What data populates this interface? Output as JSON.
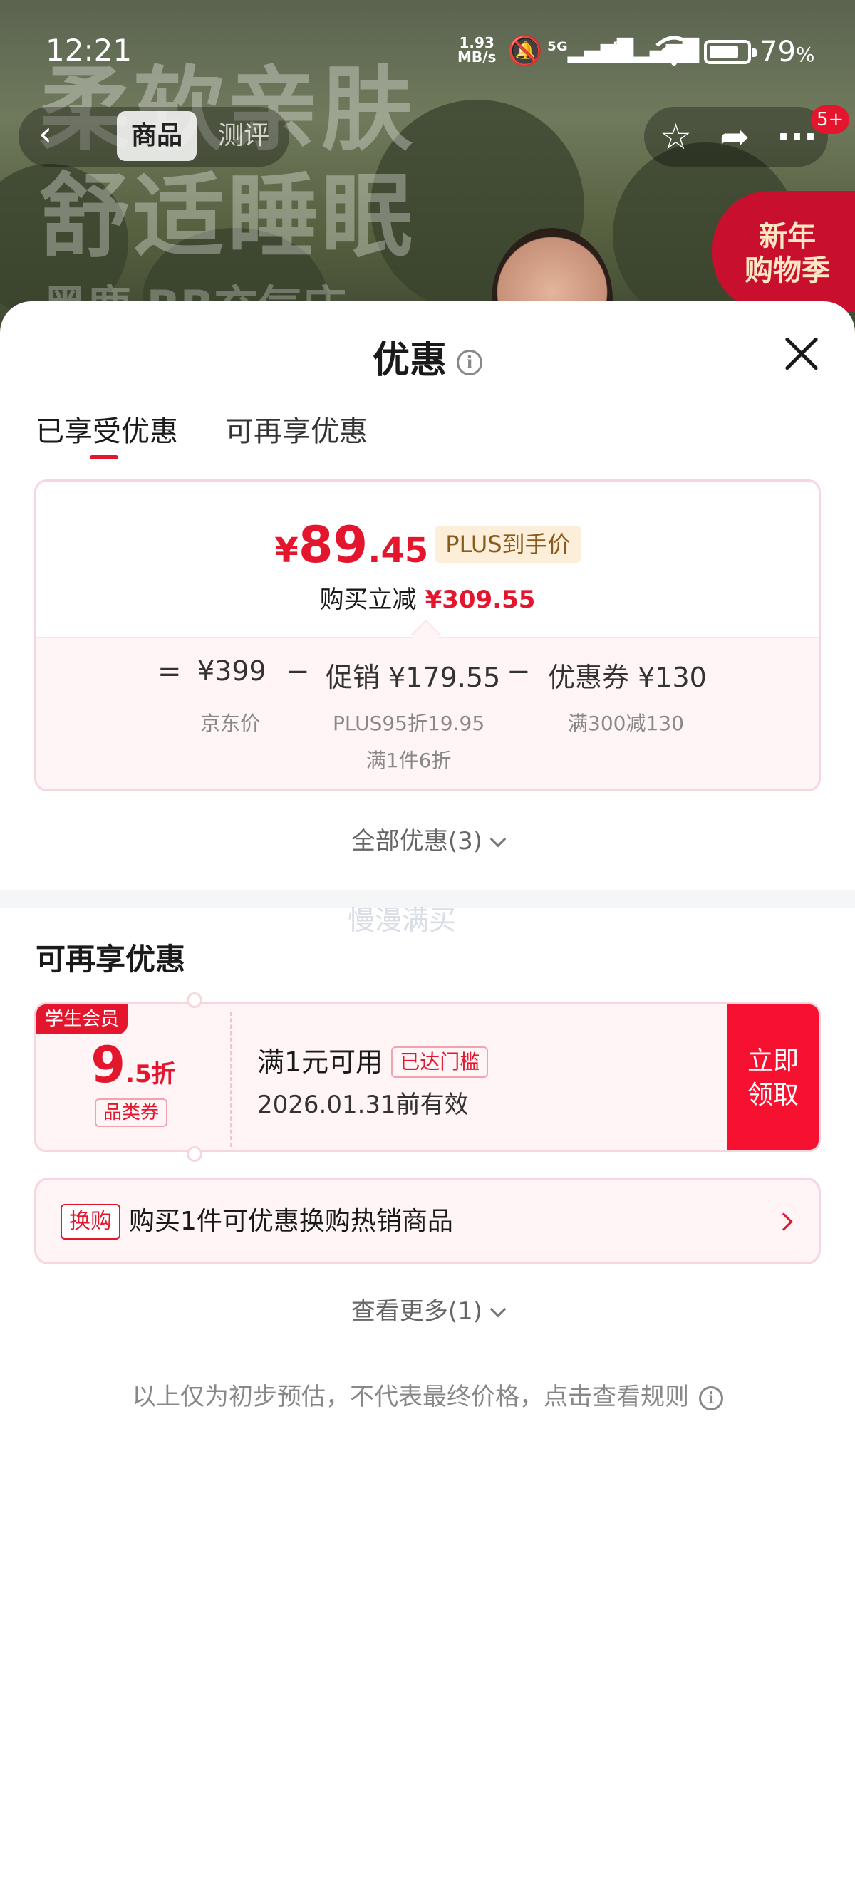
{
  "status_bar": {
    "time": "12:21",
    "net_speed_value": "1.93",
    "net_speed_unit": "MB/s",
    "battery_percent": "79",
    "battery_unit": "%",
    "battery_level": 0.79,
    "icons": [
      "mute-icon",
      "signal-5g-icon",
      "signal-5g-icon",
      "wifi-icon",
      "battery-icon"
    ]
  },
  "background": {
    "headline_line1": "柔软亲肤",
    "headline_line2": "舒适睡眠",
    "headline_line3": "黑鹿 BB充气床",
    "promo_badge_line1": "新年",
    "promo_badge_line2": "购物季"
  },
  "nav": {
    "tab_product": "商品",
    "tab_review": "测评",
    "message_badge": "5+"
  },
  "sheet": {
    "title": "优惠",
    "tabs": [
      {
        "label": "已享受优惠",
        "active": true
      },
      {
        "label": "可再享优惠",
        "active": false
      }
    ],
    "summary": {
      "price_currency": "¥",
      "price_integer": "89",
      "price_decimal": ".45",
      "price_tag": "PLUS到手价",
      "savings_label": "购买立减",
      "savings_amount": "¥309.55",
      "equals": "=",
      "minus": "−",
      "base_price": "¥399",
      "base_price_label": "京东价",
      "promo_label": "促销",
      "promo_amount": "¥179.55",
      "promo_detail_1": "PLUS95折19.95",
      "promo_detail_2": "满1件6折",
      "coupon_label": "优惠券",
      "coupon_amount": "¥130",
      "coupon_detail": "满300减130"
    },
    "all_discounts": "全部优惠(3)",
    "watermark": "慢漫满买",
    "section_title": "可再享优惠",
    "coupon": {
      "tag": "学生会员",
      "rate_big": "9",
      "rate_small": ".5折",
      "type": "品类券",
      "condition": "满1元可用",
      "reached": "已达门槛",
      "validity": "2026.01.31前有效",
      "claim_line1": "立即",
      "claim_line2": "领取"
    },
    "exchange": {
      "tag": "换购",
      "text": "购买1件可优惠换购热销商品"
    },
    "see_more": "查看更多(1)",
    "disclaimer": "以上仅为初步预估，不代表最终价格，点击查看规则"
  },
  "colors": {
    "accent_red": "#e3162e",
    "claim_red": "#f5112f",
    "plus_tag_bg": "#fdeed9",
    "card_bg": "#fff5f6"
  }
}
